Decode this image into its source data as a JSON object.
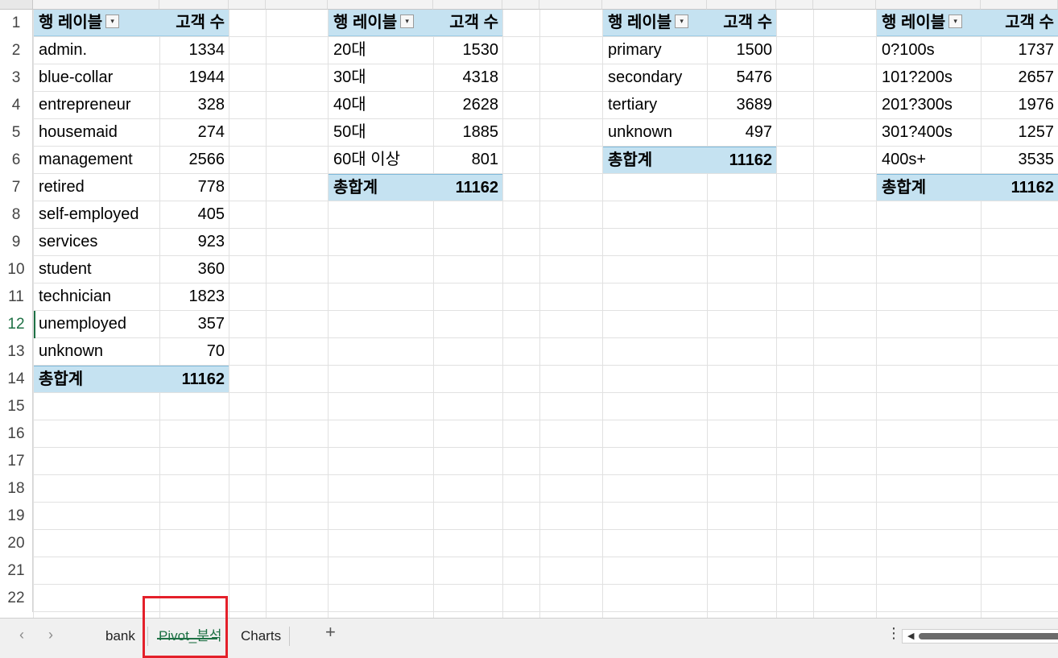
{
  "rows": [
    "1",
    "2",
    "3",
    "4",
    "5",
    "6",
    "7",
    "8",
    "9",
    "10",
    "11",
    "12",
    "13",
    "14",
    "15",
    "16",
    "17",
    "18",
    "19",
    "20",
    "21",
    "22"
  ],
  "active_row": "12",
  "pivot_job": {
    "header_label": "행 레이블",
    "header_value": "고객 수",
    "items": [
      {
        "label": "admin.",
        "value": "1334"
      },
      {
        "label": "blue-collar",
        "value": "1944"
      },
      {
        "label": "entrepreneur",
        "value": "328"
      },
      {
        "label": "housemaid",
        "value": "274"
      },
      {
        "label": "management",
        "value": "2566"
      },
      {
        "label": "retired",
        "value": "778"
      },
      {
        "label": "self-employed",
        "value": "405"
      },
      {
        "label": "services",
        "value": "923"
      },
      {
        "label": "student",
        "value": "360"
      },
      {
        "label": "technician",
        "value": "1823"
      },
      {
        "label": "unemployed",
        "value": "357"
      },
      {
        "label": "unknown",
        "value": "70"
      }
    ],
    "total_label": "총합계",
    "total_value": "11162"
  },
  "pivot_age": {
    "header_label": "행 레이블",
    "header_value": "고객 수",
    "items": [
      {
        "label": "20대",
        "value": "1530"
      },
      {
        "label": "30대",
        "value": "4318"
      },
      {
        "label": "40대",
        "value": "2628"
      },
      {
        "label": "50대",
        "value": "1885"
      },
      {
        "label": "60대 이상",
        "value": "801"
      }
    ],
    "total_label": "총합계",
    "total_value": "11162"
  },
  "pivot_education": {
    "header_label": "행 레이블",
    "header_value": "고객 수",
    "items": [
      {
        "label": "primary",
        "value": "1500"
      },
      {
        "label": "secondary",
        "value": "5476"
      },
      {
        "label": "tertiary",
        "value": "3689"
      },
      {
        "label": "unknown",
        "value": "497"
      }
    ],
    "total_label": "총합계",
    "total_value": "11162"
  },
  "pivot_balance": {
    "header_label": "행 레이블",
    "header_value": "고객 수",
    "items": [
      {
        "label": "0?100s",
        "value": "1737"
      },
      {
        "label": "101?200s",
        "value": "2657"
      },
      {
        "label": "201?300s",
        "value": "1976"
      },
      {
        "label": "301?400s",
        "value": "1257"
      },
      {
        "label": "400s+",
        "value": "3535"
      }
    ],
    "total_label": "총합계",
    "total_value": "11162"
  },
  "tabs": {
    "prev_icon": "‹",
    "next_icon": "›",
    "sheets": [
      "bank",
      "Pivot_분석",
      "Charts"
    ],
    "active": "Pivot_분석",
    "add_icon": "+",
    "more_icon": "⋮"
  },
  "colors": {
    "header_fill": "#c5e2f1",
    "accent_green": "#1e7145",
    "highlight_red": "#e4202a"
  }
}
